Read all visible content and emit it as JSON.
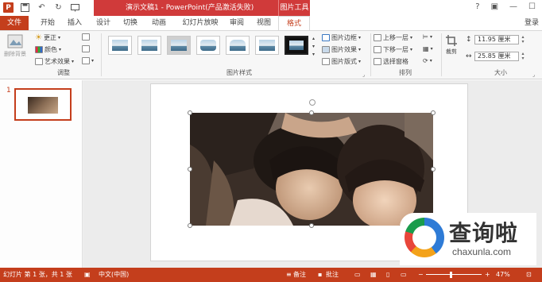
{
  "title_bar": {
    "doc_title": "演示文稿1 - PowerPoint(产品激活失败)",
    "context_tab": "图片工具",
    "ppt_icon": "P",
    "qat_icons": [
      "save-icon",
      "undo-icon",
      "redo-icon",
      "start-slideshow-icon"
    ],
    "window_controls": [
      "help-icon",
      "restore-ribbon-icon",
      "minimize-icon",
      "maximize-icon"
    ]
  },
  "tabs": [
    "文件",
    "开始",
    "插入",
    "设计",
    "切换",
    "动画",
    "幻灯片放映",
    "审阅",
    "视图",
    "格式"
  ],
  "login": "登录",
  "ribbon": {
    "remove_bg": "删除背景",
    "adjust": {
      "corrections": "更正",
      "color": "颜色",
      "artistic": "艺术效果",
      "label": "调整"
    },
    "picture_styles": {
      "label": "图片样式",
      "border": "图片边框",
      "effects": "图片效果",
      "layout": "图片版式"
    },
    "arrange": {
      "label": "排列",
      "bring_forward": "上移一层",
      "send_backward": "下移一层",
      "selection_pane": "选择窗格"
    },
    "size": {
      "label": "大小",
      "crop": "裁剪",
      "height": "11.95 厘米",
      "width": "25.85 厘米"
    }
  },
  "thumbnails": {
    "slide_number": "1"
  },
  "watermark": {
    "brand_cn": "查询啦",
    "brand_en": "chaxunla.com"
  },
  "status_bar": {
    "slide_info": "幻灯片 第 1 张，共 1 张",
    "language": "中文(中国)",
    "notes": "备注",
    "comments": "批注",
    "zoom": "47%"
  },
  "colors": {
    "accent": "#c43e1c",
    "title_band": "#d03a3a"
  }
}
